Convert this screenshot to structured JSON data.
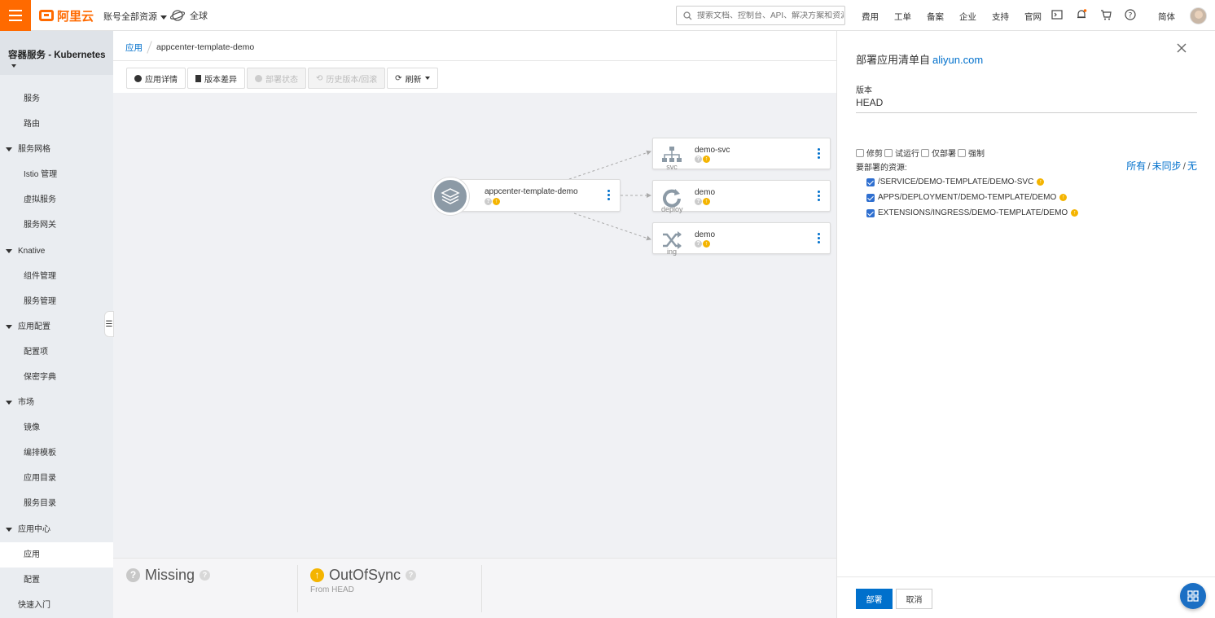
{
  "topbar": {
    "logo_text": "阿里云",
    "account_scope": "账号全部资源",
    "region": "全球",
    "search_placeholder": "搜索文档、控制台、API、解决方案和资源",
    "nav": [
      "费用",
      "工单",
      "备案",
      "企业",
      "支持",
      "官网"
    ],
    "language": "简体",
    "brand_color": "#ff6a00"
  },
  "sidebar": {
    "product": "容器服务 - Kubernetes",
    "items": [
      {
        "label": "服务",
        "type": "child"
      },
      {
        "label": "路由",
        "type": "child"
      },
      {
        "label": "服务网格",
        "type": "group"
      },
      {
        "label": "Istio 管理",
        "type": "child"
      },
      {
        "label": "虚拟服务",
        "type": "child"
      },
      {
        "label": "服务网关",
        "type": "child"
      },
      {
        "label": "Knative",
        "type": "group"
      },
      {
        "label": "组件管理",
        "type": "child"
      },
      {
        "label": "服务管理",
        "type": "child"
      },
      {
        "label": "应用配置",
        "type": "group"
      },
      {
        "label": "配置项",
        "type": "child"
      },
      {
        "label": "保密字典",
        "type": "child"
      },
      {
        "label": "市场",
        "type": "group"
      },
      {
        "label": "镜像",
        "type": "child"
      },
      {
        "label": "编排模板",
        "type": "child"
      },
      {
        "label": "应用目录",
        "type": "child"
      },
      {
        "label": "服务目录",
        "type": "child"
      },
      {
        "label": "应用中心",
        "type": "group"
      },
      {
        "label": "应用",
        "type": "child",
        "active": true
      },
      {
        "label": "配置",
        "type": "child"
      },
      {
        "label": "快速入门",
        "type": "group-plain"
      }
    ]
  },
  "breadcrumb": {
    "parent": "应用",
    "current": "appcenter-template-demo"
  },
  "toolbar": {
    "details": "应用详情",
    "diff": "版本差异",
    "deploy_status": "部署状态",
    "history": "历史版本/回滚",
    "refresh": "刷新"
  },
  "graph": {
    "root": {
      "name": "appcenter-template-demo"
    },
    "resources": [
      {
        "name": "demo-svc",
        "kind": "svc",
        "icon": "network-icon"
      },
      {
        "name": "demo",
        "kind": "deploy",
        "icon": "refresh-circle-icon"
      },
      {
        "name": "demo",
        "kind": "ing",
        "icon": "shuffle-icon"
      }
    ]
  },
  "status_bar": {
    "health": "Missing",
    "sync": "OutOfSync",
    "sync_sub": "From HEAD"
  },
  "drawer": {
    "title_prefix": "部署应用清单自",
    "title_link": "aliyun.com",
    "version_label": "版本",
    "version_value": "HEAD",
    "options": [
      "修剪",
      "试运行",
      "仅部署",
      "强制"
    ],
    "resources_label": "要部署的资源:",
    "select_links": [
      "所有",
      "未同步",
      "无"
    ],
    "resources": [
      "/SERVICE/DEMO-TEMPLATE/DEMO-SVC",
      "APPS/DEPLOYMENT/DEMO-TEMPLATE/DEMO",
      "EXTENSIONS/INGRESS/DEMO-TEMPLATE/DEMO"
    ],
    "confirm": "部署",
    "cancel": "取消"
  },
  "colors": {
    "primary": "#0070cc",
    "out_of_sync": "#f4b400",
    "unknown": "#c8c8c8"
  }
}
